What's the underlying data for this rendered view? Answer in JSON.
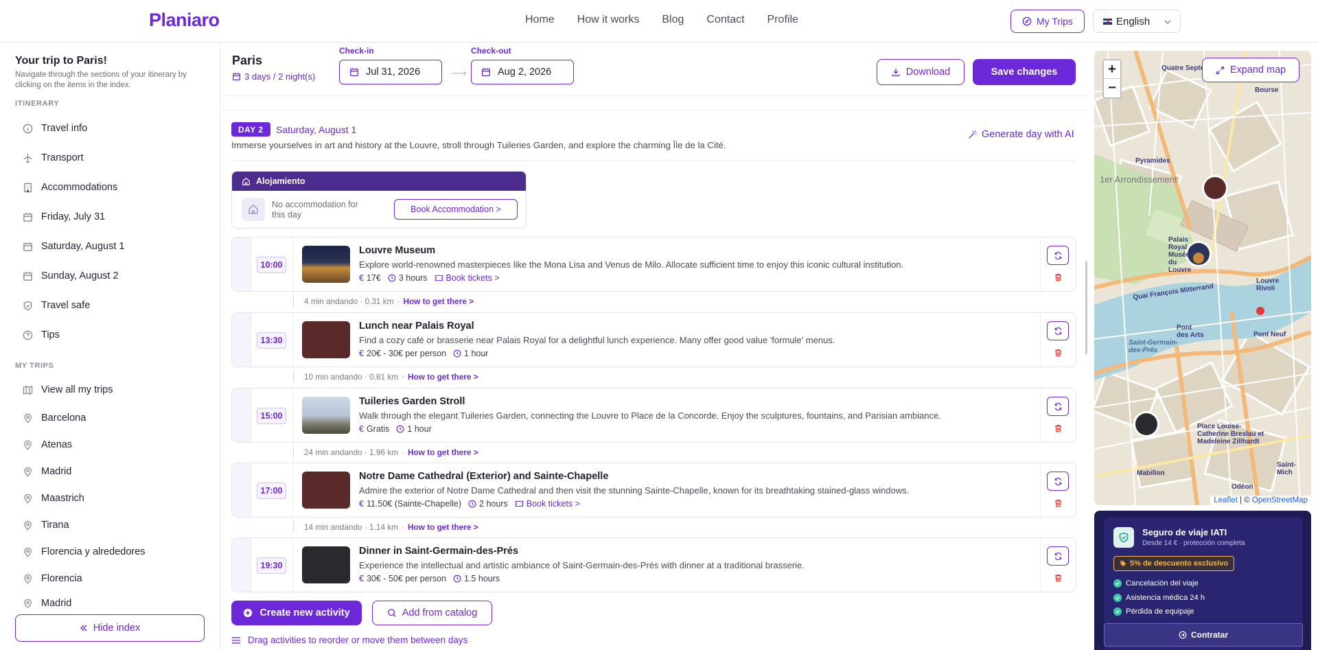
{
  "nav": {
    "logo": "Planiaro",
    "links": [
      "Home",
      "How it works",
      "Blog",
      "Contact",
      "Profile"
    ],
    "my_trips": "My Trips",
    "language": "English"
  },
  "sidebar": {
    "title": "Your trip to Paris!",
    "subtitle": "Navigate through the sections of your itinerary by clicking on the items in the index.",
    "itinerary_heading": "ITINERARY",
    "itinerary": [
      {
        "label": "Travel info",
        "icon": "info-icon"
      },
      {
        "label": "Transport",
        "icon": "plane-icon"
      },
      {
        "label": "Accommodations",
        "icon": "building-icon"
      },
      {
        "label": "Friday, July 31",
        "icon": "calendar-icon"
      },
      {
        "label": "Saturday, August 1",
        "icon": "calendar-icon"
      },
      {
        "label": "Sunday, August 2",
        "icon": "calendar-icon"
      },
      {
        "label": "Travel safe",
        "icon": "shield-icon"
      },
      {
        "label": "Tips",
        "icon": "question-icon"
      }
    ],
    "trips_heading": "MY TRIPS",
    "trips": [
      {
        "label": "View all my trips",
        "icon": "map-icon"
      },
      {
        "label": "Barcelona",
        "icon": "pin-icon"
      },
      {
        "label": "Atenas",
        "icon": "pin-icon"
      },
      {
        "label": "Madrid",
        "icon": "pin-icon"
      },
      {
        "label": "Maastrich",
        "icon": "pin-icon"
      },
      {
        "label": "Tirana",
        "icon": "pin-icon"
      },
      {
        "label": "Florencia y alrededores",
        "icon": "pin-icon"
      },
      {
        "label": "Florencia",
        "icon": "pin-icon"
      },
      {
        "label": "Madrid",
        "icon": "pin-icon"
      }
    ],
    "hide_index": "Hide index"
  },
  "trip": {
    "city": "Paris",
    "duration": "3 days / 2 night(s)",
    "checkin_label": "Check-in",
    "checkin": "Jul 31, 2026",
    "checkout_label": "Check-out",
    "checkout": "Aug 2, 2026",
    "download": "Download",
    "save": "Save changes"
  },
  "day": {
    "badge": "DAY 2",
    "date": "Saturday, August 1",
    "description": "Immerse yourselves in art and history at the Louvre, stroll through Tuileries Garden, and explore the charming Île de la Cité.",
    "generate_ai": "Generate day with AI",
    "accommodation": {
      "heading": "Alojamiento",
      "message": "No accommodation for this day",
      "book": "Book Accommodation >"
    },
    "activities": [
      {
        "time": "10:00",
        "title": "Louvre Museum",
        "desc": "Explore world-renowned masterpieces like the Mona Lisa and Venus de Milo. Allocate sufficient time to enjoy this iconic cultural institution.",
        "price": "17€",
        "duration": "3 hours",
        "tickets": "Book tickets >",
        "thumb": "louvre"
      },
      {
        "time": "13:30",
        "title": "Lunch near Palais Royal",
        "desc": "Find a cozy café or brasserie near Palais Royal for a delightful lunch experience. Many offer good value 'formule' menus.",
        "price": "20€ - 30€ per person",
        "duration": "1 hour",
        "tickets": "",
        "thumb": "brown"
      },
      {
        "time": "15:00",
        "title": "Tuileries Garden Stroll",
        "desc": "Walk through the elegant Tuileries Garden, connecting the Louvre to Place de la Concorde. Enjoy the sculptures, fountains, and Parisian ambiance.",
        "price": "Gratis",
        "duration": "1 hour",
        "tickets": "",
        "thumb": "garden"
      },
      {
        "time": "17:00",
        "title": "Notre Dame Cathedral (Exterior) and Sainte-Chapelle",
        "desc": "Admire the exterior of Notre Dame Cathedral and then visit the stunning Sainte-Chapelle, known for its breathtaking stained-glass windows.",
        "price": "11.50€ (Sainte-Chapelle)",
        "duration": "2 hours",
        "tickets": "Book tickets >",
        "thumb": "brown"
      },
      {
        "time": "19:30",
        "title": "Dinner in Saint-Germain-des-Prés",
        "desc": "Experience the intellectual and artistic ambiance of Saint-Germain-des-Prés with dinner at a traditional brasserie.",
        "price": "30€ - 50€ per person",
        "duration": "1.5 hours",
        "tickets": "",
        "thumb": "dark"
      }
    ],
    "transfers": [
      {
        "info": "4 min andando · 0.31 km",
        "link": "How to get there >"
      },
      {
        "info": "10 min andando · 0.81 km",
        "link": "How to get there >"
      },
      {
        "info": "24 min andando · 1.96 km",
        "link": "How to get there >"
      },
      {
        "info": "14 min andando · 1.14 km",
        "link": "How to get there >"
      }
    ],
    "create_activity": "Create new activity",
    "add_catalog": "Add from catalog",
    "drag_hint": "Drag activities to reorder or move them between days"
  },
  "map": {
    "expand": "Expand map",
    "zoom_in": "+",
    "zoom_out": "−",
    "attribution_leaflet": "Leaflet",
    "attribution_sep": " | © ",
    "attribution_osm": "OpenStreetMap",
    "labels": [
      "Quatre Septembre",
      "Bourse",
      "Pyramides",
      "1er Arrondissement",
      "Palais Royal Musée du Louvre",
      "Louvre Rivoli",
      "Quai François Mitterrand",
      "Pont des Arts",
      "Pont Neuf",
      "Saint-Germain-des-Prés",
      "Place Louise-Catherine Breslau et Madeleine Zillhardt",
      "Mabillon",
      "Odéon",
      "Saint-Mich"
    ]
  },
  "insurance": {
    "title": "Seguro de viaje IATI",
    "subtitle": "Desde 14 € · protección completa",
    "discount": "5% de descuento exclusivo",
    "features": [
      "Cancelación del viaje",
      "Asistencia médica 24 h",
      "Pérdida de equipaje"
    ],
    "cta": "Contratar"
  },
  "colors": {
    "accent": "#6d28d9",
    "danger": "#e23b3b",
    "insurance_bg": "#1f1b54"
  }
}
